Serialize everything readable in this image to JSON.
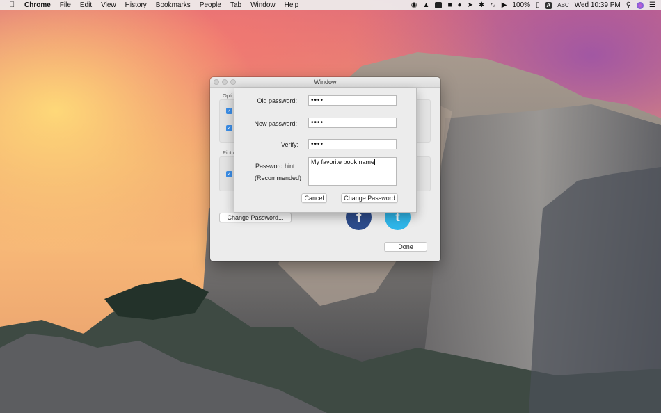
{
  "menubar": {
    "app": "Chrome",
    "items": [
      "File",
      "Edit",
      "View",
      "History",
      "Bookmarks",
      "People",
      "Tab",
      "Window",
      "Help"
    ],
    "battery": "100%",
    "input_source": "ABC",
    "clock": "Wed 10:39 PM"
  },
  "window": {
    "title": "Window",
    "options_label": "Opti",
    "pictures_label": "Pictu",
    "change_password_button": "Change Password...",
    "done_button": "Done",
    "facebook_glyph": "f",
    "twitter_glyph": "t"
  },
  "sheet": {
    "old_password_label": "Old password:",
    "old_password_value": "••••",
    "new_password_label": "New password:",
    "new_password_value": "••••",
    "verify_label": "Verify:",
    "verify_value": "••••",
    "hint_label": "Password hint:",
    "hint_sublabel": "(Recommended)",
    "hint_value": "My favorite book name",
    "cancel_button": "Cancel",
    "change_password_button": "Change Password"
  }
}
